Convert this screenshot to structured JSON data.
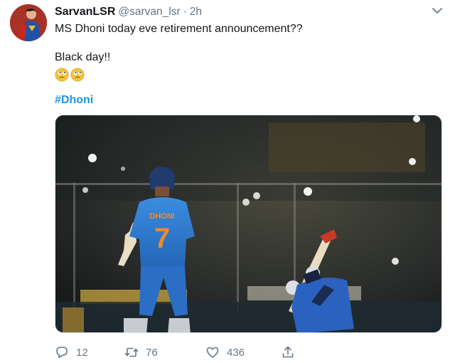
{
  "tweet": {
    "author": {
      "display_name": "SarvanLSR",
      "handle": "@sarvan_lsr",
      "separator": "·",
      "time": "2h",
      "avatar_icon": "superman-avatar-icon"
    },
    "text_lines": [
      "MS Dhoni today eve retirement announcement??",
      "Black day!!"
    ],
    "emojis": [
      "face-with-rolling-eyes-emoji",
      "face-with-rolling-eyes-emoji"
    ],
    "hashtag": "#Dhoni",
    "media": {
      "jersey_name": "DHONI",
      "jersey_number": "7"
    },
    "actions": {
      "reply_count": "12",
      "retweet_count": "76",
      "like_count": "436"
    }
  },
  "colors": {
    "text": "#14171a",
    "secondary": "#657786",
    "link": "#1b95e0",
    "jersey_blue": "#2f7fd6"
  }
}
